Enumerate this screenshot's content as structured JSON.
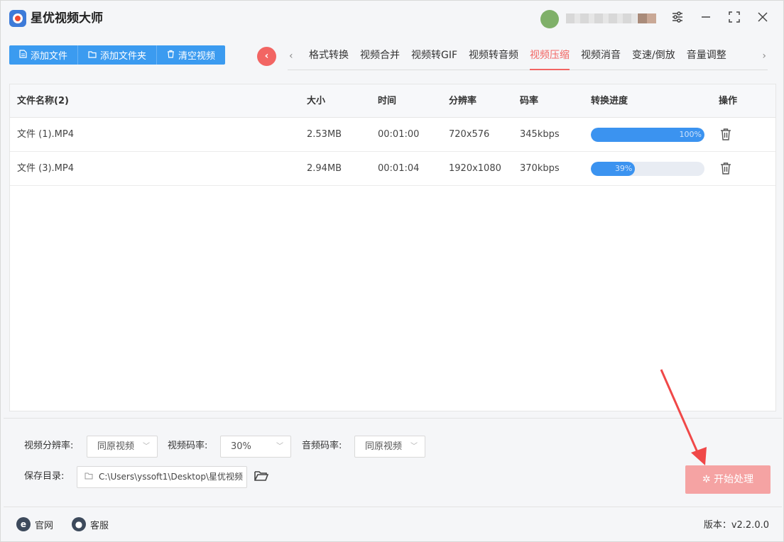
{
  "app": {
    "title": "星优视频大师"
  },
  "toolbar": {
    "add_file": "添加文件",
    "add_folder": "添加文件夹",
    "clear_videos": "清空视频"
  },
  "tabs": [
    {
      "label": "格式转换"
    },
    {
      "label": "视频合并"
    },
    {
      "label": "视频转GIF"
    },
    {
      "label": "视频转音频"
    },
    {
      "label": "视频压缩",
      "active": true
    },
    {
      "label": "视频消音"
    },
    {
      "label": "变速/倒放"
    },
    {
      "label": "音量调整"
    }
  ],
  "table": {
    "headers": {
      "name": "文件名称(2)",
      "size": "大小",
      "time": "时间",
      "resolution": "分辨率",
      "bitrate": "码率",
      "progress": "转换进度",
      "action": "操作"
    },
    "rows": [
      {
        "name": "文件 (1).MP4",
        "size": "2.53MB",
        "time": "00:01:00",
        "resolution": "720x576",
        "bitrate": "345kbps",
        "progress_label": "100%",
        "progress": 100
      },
      {
        "name": "文件 (3).MP4",
        "size": "2.94MB",
        "time": "00:01:04",
        "resolution": "1920x1080",
        "bitrate": "370kbps",
        "progress_label": "39%",
        "progress": 39
      }
    ]
  },
  "settings": {
    "video_resolution_label": "视频分辨率:",
    "video_resolution_value": "同原视频",
    "video_bitrate_label": "视频码率:",
    "video_bitrate_value": "30%",
    "audio_bitrate_label": "音频码率:",
    "audio_bitrate_value": "同原视频",
    "save_dir_label": "保存目录:",
    "save_dir_value": "C:\\Users\\yssoft1\\Desktop\\星优视频",
    "start_label": "开始处理"
  },
  "footer": {
    "website": "官网",
    "support": "客服",
    "version": "版本：v2.2.0.0"
  },
  "colors": {
    "primary_blue": "#3b9bf0",
    "accent_red": "#f26563",
    "start_button": "#f5a3a3"
  }
}
